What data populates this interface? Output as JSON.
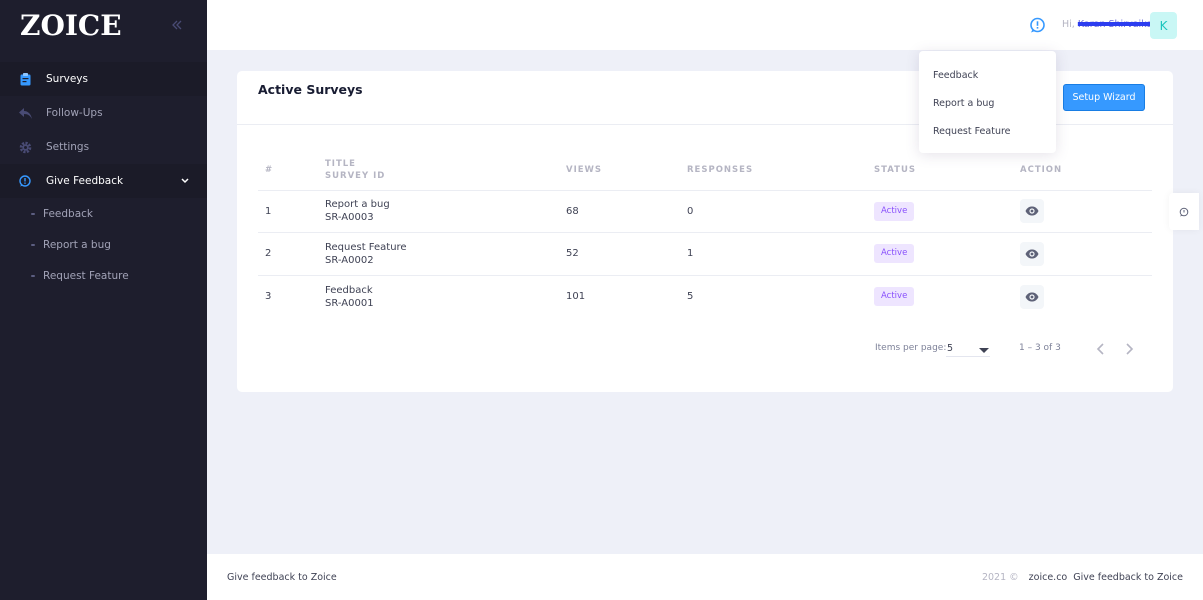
{
  "brand": {
    "logo": "ZOICE",
    "collapse_icon": "double-chevron-left-icon"
  },
  "sidebar": {
    "items": [
      {
        "label": "Surveys",
        "icon": "clipboard-icon"
      },
      {
        "label": "Follow-Ups",
        "icon": "reply-icon"
      },
      {
        "label": "Settings",
        "icon": "gear-icon"
      },
      {
        "label": "Give Feedback",
        "icon": "chat-icon"
      }
    ],
    "subitems": [
      "Feedback",
      "Report a bug",
      "Request Feature"
    ]
  },
  "header": {
    "greeting": "Hi,",
    "user_name": "Karan Shirvaikar",
    "avatar_letter": "K"
  },
  "card": {
    "title": "Active Surveys",
    "wizard_button": "Setup Wizard",
    "columns": {
      "num": "#",
      "title": "TITLE",
      "survey_id": "SURVEY ID",
      "views": "VIEWS",
      "responses": "RESPONSES",
      "status": "STATUS",
      "action": "ACTION"
    },
    "rows": [
      {
        "num": "1",
        "title": "Report a bug",
        "id": "SR-A0003",
        "views": "68",
        "responses": "0",
        "status": "Active"
      },
      {
        "num": "2",
        "title": "Request Feature",
        "id": "SR-A0002",
        "views": "52",
        "responses": "1",
        "status": "Active"
      },
      {
        "num": "3",
        "title": "Feedback",
        "id": "SR-A0001",
        "views": "101",
        "responses": "5",
        "status": "Active"
      }
    ],
    "pager": {
      "label": "Items per page:",
      "value": "5",
      "range": "1 – 3 of 3"
    }
  },
  "dropdown": {
    "items": [
      "Feedback",
      "Report a bug",
      "Request Feature"
    ]
  },
  "footer": {
    "left": "Give feedback to Zoice",
    "year": "2021 ©",
    "link": "zoice.co",
    "right": "Give feedback to Zoice"
  },
  "colors": {
    "sidebar_bg": "#1e1e2d",
    "primary": "#3699ff",
    "badge_bg": "#eee5ff",
    "badge_text": "#8950fc",
    "avatar_bg": "#c9f7f5",
    "avatar_text": "#1bc5bd"
  }
}
